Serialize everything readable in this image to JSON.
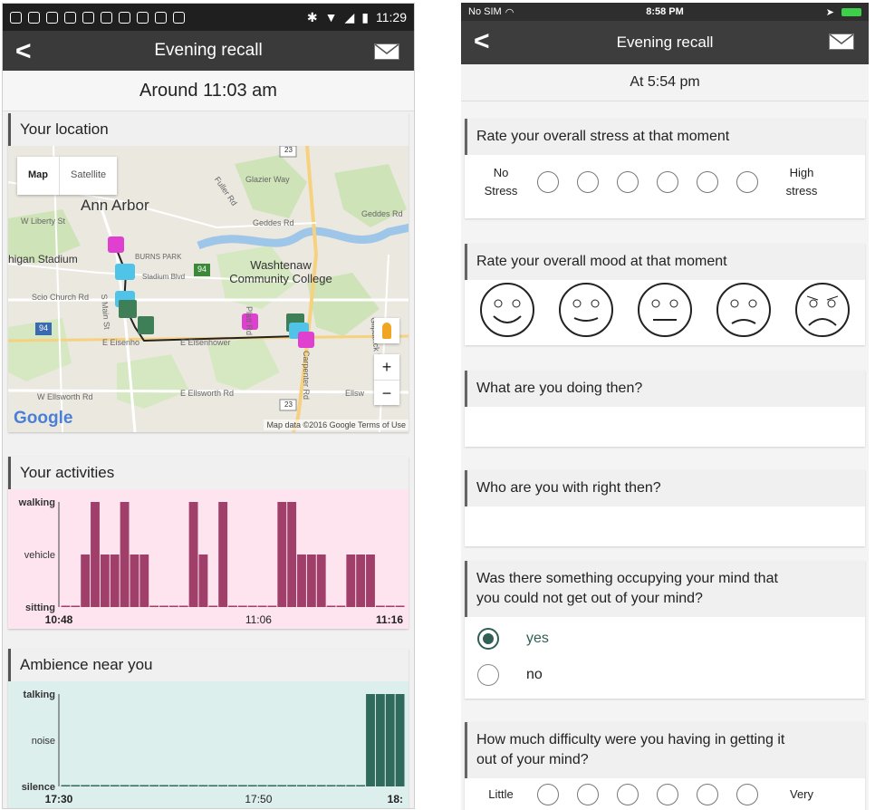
{
  "left": {
    "status_time": "11:29",
    "title": "Evening recall",
    "time_header": "Around 11:03 am",
    "location": {
      "title": "Your location",
      "map_type_labels": [
        "Map",
        "Satellite"
      ],
      "city": "Ann Arbor",
      "labels": {
        "stadium": "higan Stadium",
        "burns_park": "BURNS PARK",
        "college": "Washtenaw Community College",
        "scio": "Scio Church Rd",
        "liberty": "W Liberty St",
        "stadium_blvd": "Stadium Blvd",
        "main_st": "S Main St",
        "eisenhower": "E Eisenho",
        "eisenhower2": "E Eisenhower",
        "ellsworth_w": "W Ellsworth Rd",
        "ellsworth_e": "E Ellsworth Rd",
        "glazier": "Glazier Way",
        "geddes": "Geddes Rd",
        "geddes2": "Geddes Rd",
        "fuller": "Fuller Rd",
        "platt": "Platt Rd",
        "carpenter": "Carpenter Rd",
        "gilpatrick": "Gilpatrick Rd",
        "ellsw": "Ellsw",
        "shield_23a": "23",
        "shield_23b": "23",
        "shield_94a": "94",
        "shield_94b": "94"
      },
      "zoom_in": "+",
      "zoom_out": "−",
      "google": "Google",
      "attribution": "Map data ©2016 Google",
      "terms": "Terms of Use"
    },
    "activities": {
      "title": "Your activities",
      "chart_data": {
        "type": "bar",
        "ylevels": [
          "sitting",
          "vehicle",
          "walking"
        ],
        "values": [
          0,
          0,
          1,
          2,
          1,
          1,
          2,
          1,
          1,
          0,
          0,
          0,
          0,
          2,
          1,
          0,
          2,
          0,
          0,
          0,
          0,
          0,
          2,
          2,
          1,
          1,
          1,
          0,
          0,
          1,
          1,
          1,
          0,
          0,
          0
        ],
        "xticks": [
          "10:48",
          "11:06",
          "11:16"
        ],
        "color": "#a0406a",
        "background": "#fde4ee"
      }
    },
    "ambience": {
      "title": "Ambience near you",
      "chart_data": {
        "type": "bar",
        "ylevels": [
          "silence",
          "noise",
          "talking"
        ],
        "values": [
          0,
          0,
          0,
          0,
          0,
          0,
          0,
          0,
          0,
          0,
          0,
          0,
          0,
          0,
          0,
          0,
          0,
          0,
          0,
          0,
          0,
          0,
          0,
          0,
          0,
          0,
          0,
          0,
          0,
          0,
          0,
          2,
          2,
          2,
          2
        ],
        "xticks": [
          "17:30",
          "17:50",
          "18:"
        ],
        "color": "#2f6a5c",
        "background": "#dcefec"
      }
    }
  },
  "right": {
    "status_left": "No SIM",
    "status_time": "8:58 PM",
    "title": "Evening recall",
    "time_header": "At 5:54 pm",
    "q_stress": {
      "title": "Rate your overall stress at that moment",
      "low_line1": "No",
      "low_line2": "Stress",
      "high_line1": "High",
      "high_line2": "stress"
    },
    "q_mood": {
      "title": "Rate your overall mood at that moment",
      "faces": [
        "very-happy-face-icon",
        "happy-face-icon",
        "neutral-face-icon",
        "sad-face-icon",
        "very-sad-face-icon"
      ]
    },
    "q_doing": {
      "title": "What are you doing then?"
    },
    "q_with": {
      "title": "Who are you with right then?"
    },
    "q_occupy": {
      "title_line1": "Was there something occupying your mind that",
      "title_line2": "you could not get out of your mind?",
      "options": [
        "yes",
        "no"
      ],
      "selected": "yes"
    },
    "q_difficulty": {
      "title_line1": "How much difficulty were you having in getting it",
      "title_line2": "out of your mind?",
      "low": "Little",
      "high": "Very"
    }
  }
}
